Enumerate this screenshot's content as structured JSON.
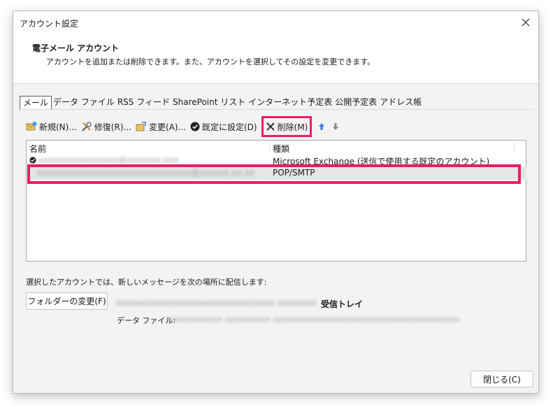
{
  "window": {
    "title": "アカウント設定"
  },
  "header": {
    "title": "電子メール アカウント",
    "description": "アカウントを追加または削除できます。また、アカウントを選択してその設定を変更できます。"
  },
  "tabs": [
    {
      "label": "メール",
      "active": true
    },
    {
      "label": "データ ファイル"
    },
    {
      "label": "RSS フィード"
    },
    {
      "label": "SharePoint リスト"
    },
    {
      "label": "インターネット予定表"
    },
    {
      "label": "公開予定表"
    },
    {
      "label": "アドレス帳"
    }
  ],
  "toolbar": {
    "new_label": "新規(N)...",
    "repair_label": "修復(R)...",
    "change_label": "変更(A)...",
    "default_label": "既定に設定(D)",
    "delete_label": "削除(M)"
  },
  "list": {
    "col_name": "名前",
    "col_type": "種類",
    "rows": [
      {
        "name": "xxxxxxxxxxxxxxxx@xxxxxxx.xxx",
        "type": "Microsoft Exchange (送信で使用する既定のアカウント)",
        "default": true
      },
      {
        "name": "xxxxxxxxxxxxxxxxxxxxxxxxxxxxxxx@xxxxxx.xx.xx",
        "type": "POP/SMTP",
        "default": false
      }
    ]
  },
  "delivery": {
    "label": "選択したアカウントでは、新しいメッセージを次の場所に配信します:",
    "folder_button": "フォルダーの変更(F)",
    "inbox_path": "xxxxxxxxxxxxxxxxxxxxxxxxxxxxxxxx xxxxxxxx",
    "inbox_name": "受信トレイ",
    "datafile_label": "データ ファイル:",
    "datafile_path": "xxxxxxxxxxxx xxxxxxxxxx xxxxxxxxxxxxxxxxxxxxxxxxxxxxxxxxxxxxxxxxx"
  },
  "footer": {
    "close_label": "閉じる(C)"
  },
  "colors": {
    "highlight": "#ee1b66",
    "selected_row": "#e5e5e5",
    "dialog_bg": "#f3f3f3"
  }
}
